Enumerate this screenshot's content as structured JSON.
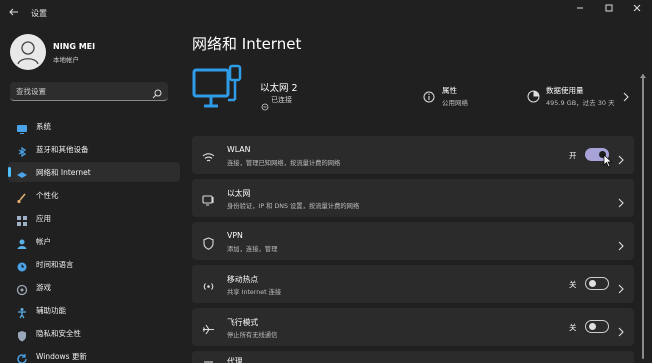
{
  "window": {
    "title": "设置",
    "back_icon": "back-arrow-icon",
    "minimize_icon": "minimize-icon",
    "maximize_icon": "maximize-icon",
    "close_icon": "close-icon"
  },
  "profile": {
    "name": "NING MEI",
    "account_type": "本地帐户"
  },
  "search": {
    "placeholder": "查找设置"
  },
  "sidebar": {
    "items": [
      {
        "label": "系统",
        "icon": "monitor-icon"
      },
      {
        "label": "蓝牙和其他设备",
        "icon": "bluetooth-icon"
      },
      {
        "label": "网络和 Internet",
        "icon": "wifi-diamond-icon",
        "active": true
      },
      {
        "label": "个性化",
        "icon": "brush-icon"
      },
      {
        "label": "应用",
        "icon": "apps-icon"
      },
      {
        "label": "帐户",
        "icon": "person-icon"
      },
      {
        "label": "时间和语言",
        "icon": "globe-clock-icon"
      },
      {
        "label": "游戏",
        "icon": "gamepad-icon"
      },
      {
        "label": "辅助功能",
        "icon": "accessibility-icon"
      },
      {
        "label": "隐私和安全性",
        "icon": "shield-icon"
      },
      {
        "label": "Windows 更新",
        "icon": "update-icon"
      }
    ]
  },
  "main": {
    "title": "网络和 Internet",
    "ethernet": {
      "name": "以太网 2",
      "status": "已连接"
    },
    "properties": {
      "title": "属性",
      "subtitle": "公用网络"
    },
    "data_usage": {
      "title": "数据使用量",
      "subtitle": "495.9 GB，过去 30 天"
    },
    "cards": [
      {
        "title": "WLAN",
        "subtitle": "连接，管理已知网络，按流量计费的网络",
        "icon": "wifi-icon",
        "toggle": "开",
        "toggle_on": true
      },
      {
        "title": "以太网",
        "subtitle": "身份验证，IP 和 DNS 设置，按流量计费的网络",
        "icon": "ethernet-icon"
      },
      {
        "title": "VPN",
        "subtitle": "添加，连接，管理",
        "icon": "vpn-shield-icon"
      },
      {
        "title": "移动热点",
        "subtitle": "共享 Internet 连接",
        "icon": "hotspot-icon",
        "toggle": "关",
        "toggle_on": false
      },
      {
        "title": "飞行模式",
        "subtitle": "停止所有无线通信",
        "icon": "airplane-icon",
        "toggle": "关",
        "toggle_on": false
      },
      {
        "title": "代理",
        "subtitle": "",
        "icon": "proxy-icon"
      }
    ]
  },
  "colors": {
    "background": "#202020",
    "card": "#2b2b2b",
    "accent": "#4cc2ff",
    "toggle_on": "#a7a2d8"
  }
}
